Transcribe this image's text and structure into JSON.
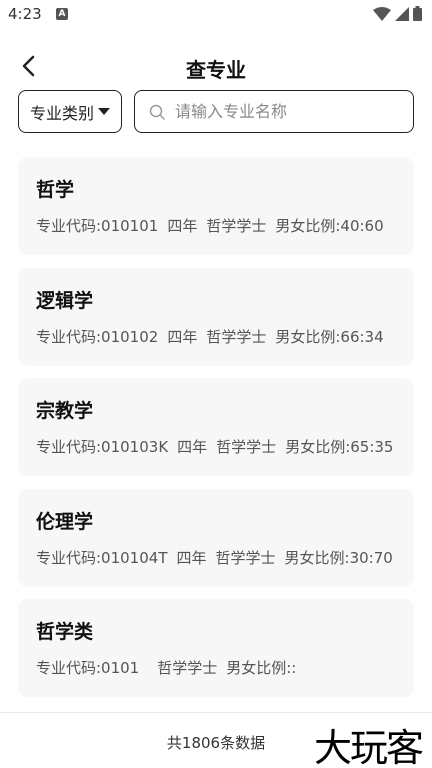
{
  "status": {
    "time": "4:23",
    "notification_badge": "A"
  },
  "header": {
    "title": "查专业"
  },
  "filter": {
    "category_label": "专业类别",
    "search_placeholder": "请输入专业名称"
  },
  "majors": [
    {
      "name": "哲学",
      "code": "专业代码:010101",
      "duration": "四年",
      "degree": "哲学学士",
      "ratio": "男女比例:40:60"
    },
    {
      "name": "逻辑学",
      "code": "专业代码:010102",
      "duration": "四年",
      "degree": "哲学学士",
      "ratio": "男女比例:66:34"
    },
    {
      "name": "宗教学",
      "code": "专业代码:010103K",
      "duration": "四年",
      "degree": "哲学学士",
      "ratio": "男女比例:65:35"
    },
    {
      "name": "伦理学",
      "code": "专业代码:010104T",
      "duration": "四年",
      "degree": "哲学学士",
      "ratio": "男女比例:30:70"
    },
    {
      "name": "哲学类",
      "code": "专业代码:0101",
      "duration": "",
      "degree": "哲学学士",
      "ratio": "男女比例::"
    }
  ],
  "footer": {
    "total": "共1806条数据",
    "watermark": "大玩客"
  },
  "colors": {
    "card_bg": "#f7f7f7",
    "border": "#222222"
  }
}
